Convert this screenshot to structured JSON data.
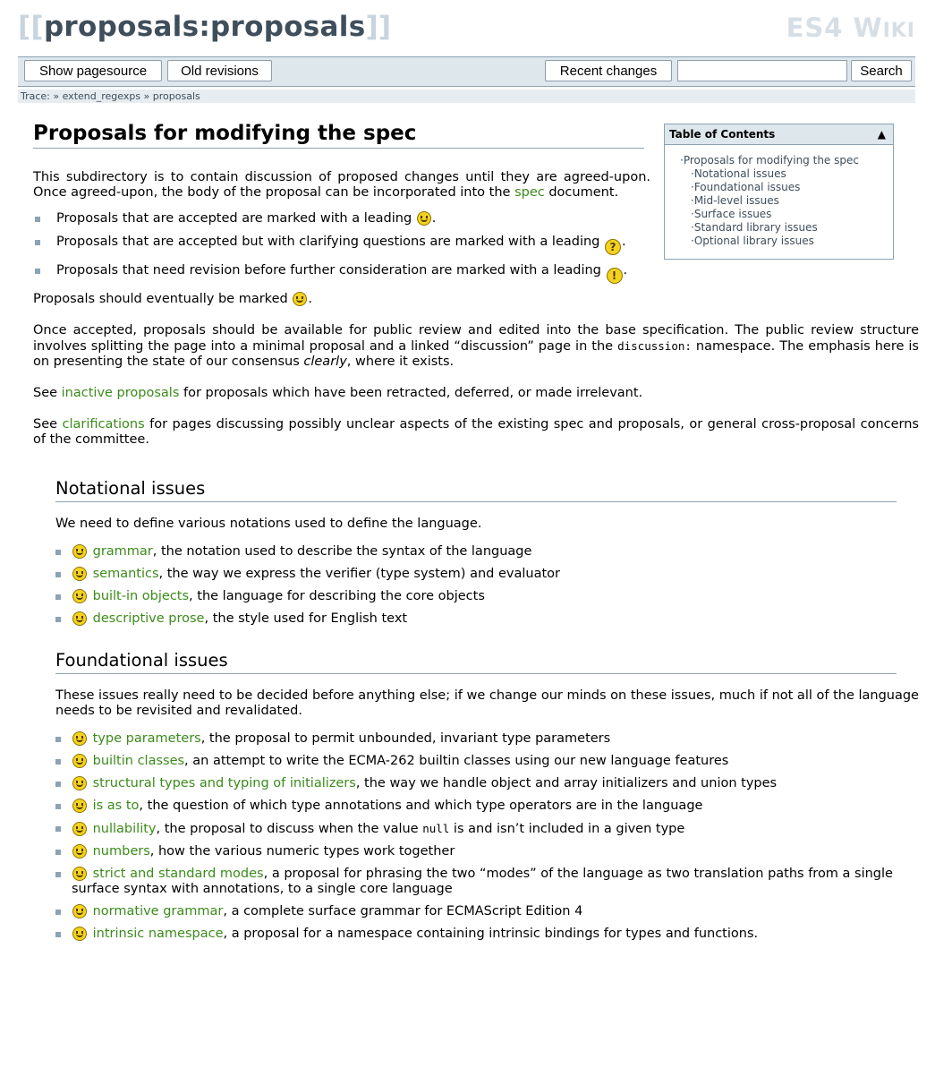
{
  "header": {
    "open_brackets": "[[",
    "title": "proposals:proposals",
    "close_brackets": "]]",
    "logo_main": "ES4 W",
    "logo_small": "IKI"
  },
  "toolbar": {
    "show_source": "Show pagesource",
    "old_revisions": "Old revisions",
    "recent_changes": "Recent changes",
    "search_value": "",
    "search_button": "Search"
  },
  "trace": {
    "text": "Trace: » extend_regexps » proposals"
  },
  "toc": {
    "title": "Table of Contents",
    "toggle": "▲",
    "top": "Proposals for modifying the spec",
    "items": [
      "Notational issues",
      "Foundational issues",
      "Mid-level issues",
      "Surface issues",
      "Standard library issues",
      "Optional library issues"
    ]
  },
  "main": {
    "heading": "Proposals for modifying the spec",
    "intro_before": "This subdirectory is to contain discussion of proposed changes until they are agreed-upon. Once agreed-upon, the body of the proposal can be incorporated into the ",
    "intro_link": "spec",
    "intro_after": " document.",
    "markers": [
      "Proposals that are accepted are marked with a leading ",
      "Proposals that are accepted but with clarifying questions are marked with a leading ",
      "Proposals that need revision before further consideration are marked with a leading "
    ],
    "eventually": "Proposals should eventually be marked ",
    "review_1": "Once accepted, proposals should be available for public review and edited into the base specification. The public review structure involves splitting the page into a minimal proposal and a linked “discussion” page in the ",
    "review_code": "discussion:",
    "review_2": " namespace. The emphasis here is on presenting the state of our consensus ",
    "review_em": "clearly",
    "review_3": ", where it exists.",
    "inactive_pre": "See ",
    "inactive_link": "inactive proposals",
    "inactive_post": " for proposals which have been retracted, deferred, or made irrelevant.",
    "clar_pre": "See ",
    "clar_link": "clarifications",
    "clar_post": " for pages discussing possibly unclear aspects of the existing spec and proposals, or general cross-proposal concerns of the committee."
  },
  "notational": {
    "heading": "Notational issues",
    "intro": "We need to define various notations used to define the language.",
    "items": [
      {
        "link": "grammar",
        "desc": ", the notation used to describe the syntax of the language"
      },
      {
        "link": "semantics",
        "desc": ", the way we express the verifier (type system) and evaluator"
      },
      {
        "link": "built-in objects",
        "desc": ", the language for describing the core objects"
      },
      {
        "link": "descriptive prose",
        "desc": ", the style used for English text"
      }
    ]
  },
  "foundational": {
    "heading": "Foundational issues",
    "intro": "These issues really need to be decided before anything else; if we change our minds on these issues, much if not all of the language needs to be revisited and revalidated.",
    "items": [
      {
        "link": "type parameters",
        "desc": ", the proposal to permit unbounded, invariant type parameters"
      },
      {
        "link": "builtin classes",
        "desc": ", an attempt to write the ECMA-262 builtin classes using our new language features"
      },
      {
        "link": "structural types and typing of initializers",
        "desc": ", the way we handle object and array initializers and union types"
      },
      {
        "link": "is as to",
        "desc": ", the question of which type annotations and which type operators are in the language"
      },
      {
        "link": "nullability",
        "desc_pre": ", the proposal to discuss when the value ",
        "code": "null",
        "desc": " is and isn’t included in a given type"
      },
      {
        "link": "numbers",
        "desc": ", how the various numeric types work together"
      },
      {
        "link": "strict and standard modes",
        "desc": ", a proposal for phrasing the two “modes” of the language as two translation paths from a single surface syntax with annotations, to a single core language"
      },
      {
        "link": "normative grammar",
        "desc": ", a complete surface grammar for ECMAScript Edition 4"
      },
      {
        "link": "intrinsic namespace",
        "desc": ", a proposal for a namespace containing intrinsic bindings for types and functions."
      }
    ]
  }
}
